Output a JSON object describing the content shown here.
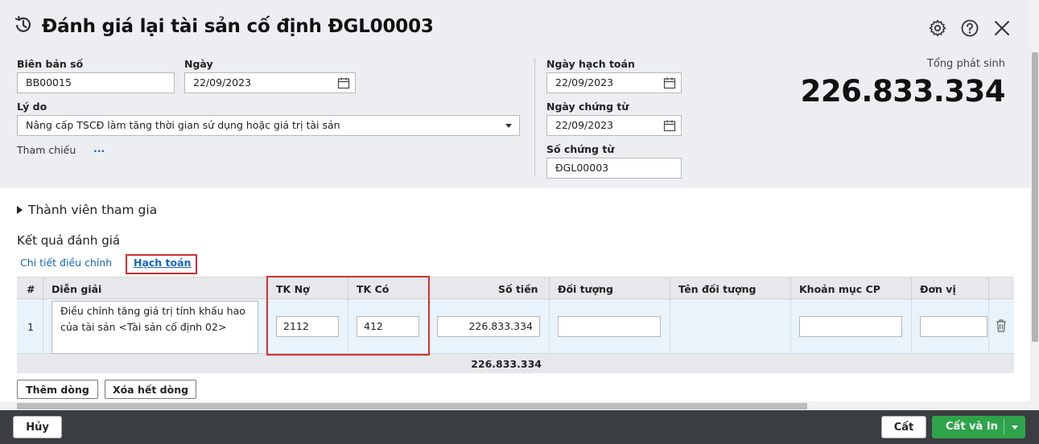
{
  "dialog": {
    "title": "Đánh giá lại tài sản cố định ĐGL00003"
  },
  "form": {
    "report_no_label": "Biên bản số",
    "report_no_value": "BB00015",
    "date_label": "Ngày",
    "date_value": "22/09/2023",
    "reason_label": "Lý do",
    "reason_value": "Nâng cấp TSCĐ làm tăng thời gian sử dụng hoặc giá trị tài sản",
    "reference_label": "Tham chiếu",
    "reference_link": "...",
    "posting_date_label": "Ngày hạch toán",
    "posting_date_value": "22/09/2023",
    "voucher_date_label": "Ngày chứng từ",
    "voucher_date_value": "22/09/2023",
    "voucher_no_label": "Số chứng từ",
    "voucher_no_value": "ĐGL00003"
  },
  "summary": {
    "total_label": "Tổng phát sinh",
    "total_value": "226.833.334"
  },
  "members_section": "Thành viên tham gia",
  "results_section": "Kết quả đánh giá",
  "tabs": {
    "detail": "Chi tiết điều chỉnh",
    "accounting": "Hạch toán"
  },
  "grid": {
    "headers": {
      "index": "#",
      "description": "Diễn giải",
      "debit": "TK Nợ",
      "credit": "TK Có",
      "amount": "Số tiền",
      "object": "Đối tượng",
      "object_name": "Tên đối tượng",
      "expense_item": "Khoản mục CP",
      "unit": "Đơn vị"
    },
    "rows": [
      {
        "index": "1",
        "description": "Điều chỉnh tăng giá trị tính khấu hao của tài sản <Tài sản cố định 02>",
        "debit": "2112",
        "credit": "412",
        "amount": "226.833.334",
        "object": "",
        "object_name": "",
        "expense_item": "",
        "unit": ""
      }
    ],
    "footer_total": "226.833.334"
  },
  "buttons": {
    "add_row": "Thêm dòng",
    "clear_rows": "Xóa hết dòng",
    "cancel": "Hủy",
    "save": "Cất",
    "save_print": "Cất và In"
  },
  "icons": {
    "title": "history-icon",
    "settings": "gear-icon",
    "help": "help-icon",
    "close": "close-icon",
    "calendar": "calendar-icon",
    "delete": "trash-icon"
  }
}
